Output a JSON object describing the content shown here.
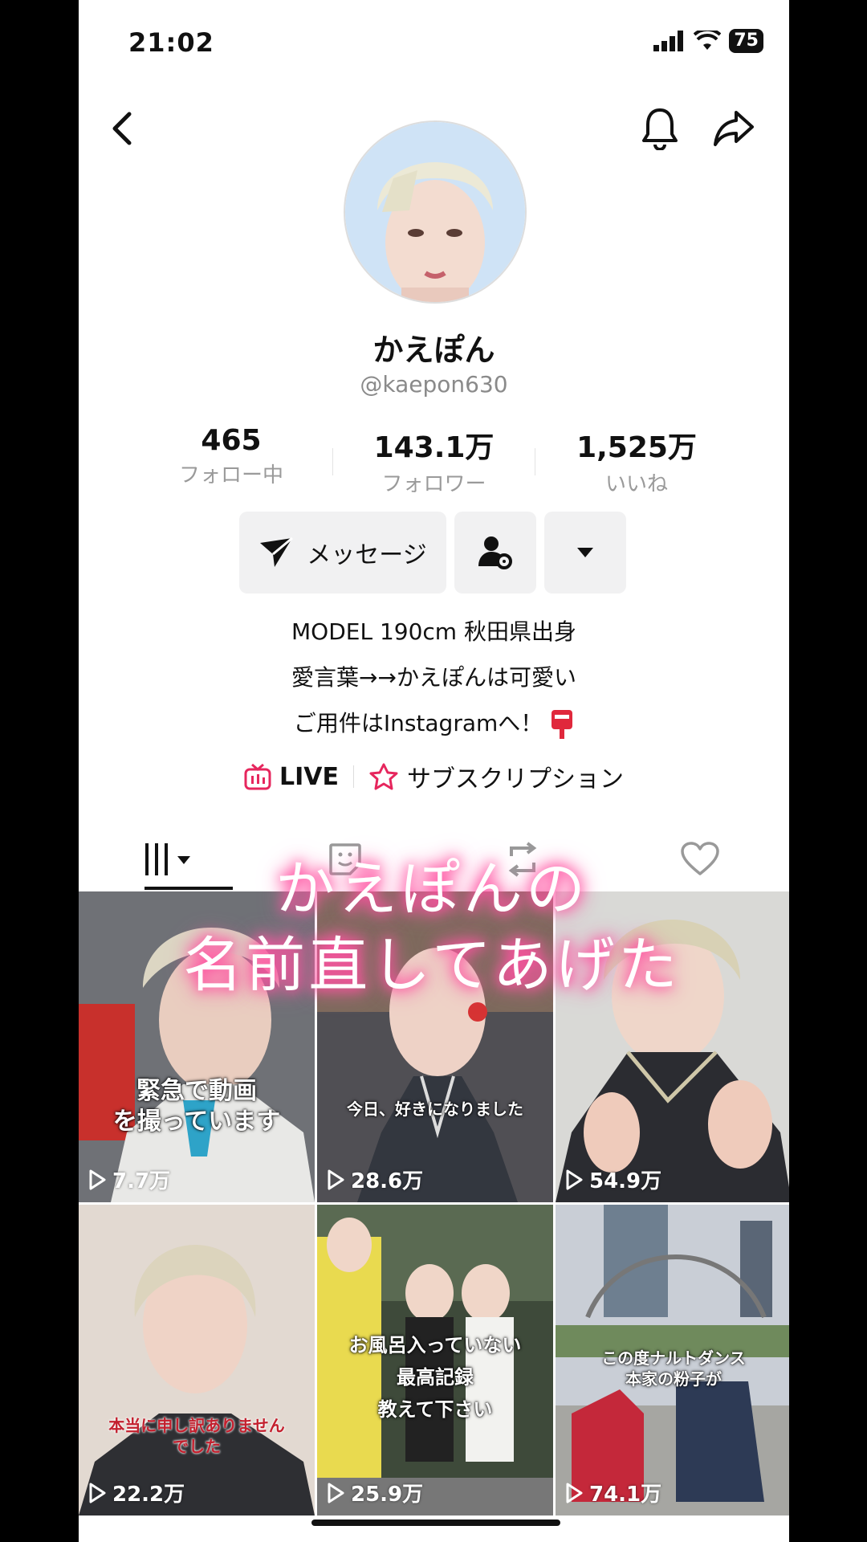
{
  "status": {
    "time": "21:02",
    "battery": "75"
  },
  "profile": {
    "name": "かえぽん",
    "handle": "@kaepon630",
    "stats": [
      {
        "num": "465",
        "label": "フォロー中"
      },
      {
        "num": "143.1万",
        "label": "フォロワー"
      },
      {
        "num": "1,525万",
        "label": "いいね"
      }
    ],
    "message_label": "メッセージ",
    "bio": [
      "MODEL 190cm 秋田県出身",
      "愛言葉→→かえぽんは可愛い",
      "ご用件はInstagramへ！"
    ],
    "links": {
      "live": "LIVE",
      "subscription": "サブスクリプション"
    }
  },
  "overlay": {
    "line1": "かえぽんの",
    "line2": "名前直してあげた"
  },
  "videos": [
    {
      "views": "7.7万",
      "caption": "緊急で動画\nを撮っています",
      "bg": "#6d6a6c"
    },
    {
      "views": "28.6万",
      "caption": "今日、好きになりました",
      "bg": "#3d3f47"
    },
    {
      "views": "54.9万",
      "caption": "",
      "bg": "#2f2f33"
    },
    {
      "views": "22.2万",
      "caption": "本当に申し訳ありません\nでした",
      "bg": "#b9aea6"
    },
    {
      "views": "25.9万",
      "caption": "お風呂入っていない\n最高記録\n教えて下さい",
      "bg": "#45503f"
    },
    {
      "views": "74.1万",
      "caption": "この度ナルトダンス\n本家の粉子が",
      "bg": "#8f969e"
    }
  ],
  "colors": {
    "accent": "#fe2c55",
    "overlay_glow": "#ff4fa0",
    "button_bg": "#f1f1f2"
  }
}
